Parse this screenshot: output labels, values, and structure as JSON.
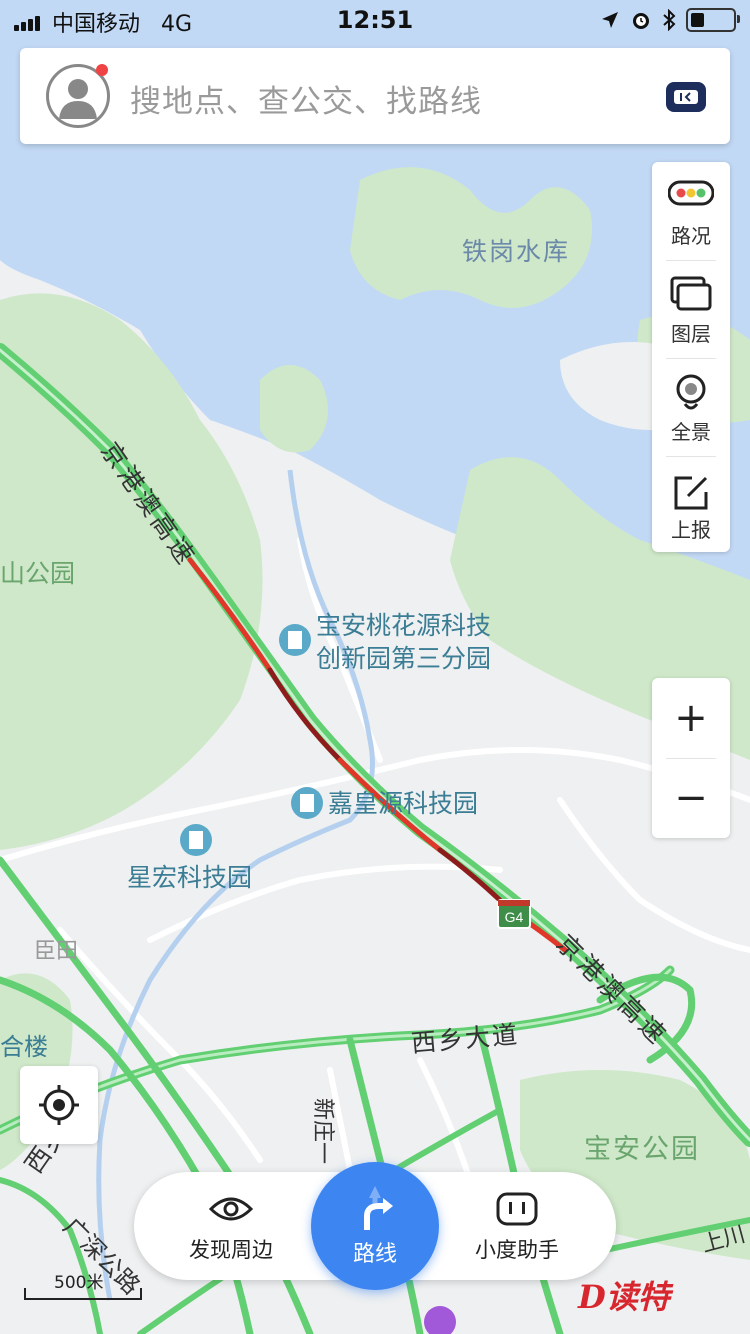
{
  "status_bar": {
    "carrier": "中国移动",
    "network": "4G",
    "time": "12:51"
  },
  "search": {
    "placeholder": "搜地点、查公交、找路线",
    "has_notification": true
  },
  "map_tools": [
    {
      "label": "路况",
      "icon": "traffic-light-icon"
    },
    {
      "label": "图层",
      "icon": "layers-icon"
    },
    {
      "label": "全景",
      "icon": "panorama-pin-icon"
    },
    {
      "label": "上报",
      "icon": "report-edit-icon"
    }
  ],
  "zoom": {
    "in": "+",
    "out": "−"
  },
  "map_labels": {
    "reservoir": "铁岗水库",
    "park_left": "山公园",
    "highway_upper": "京港澳高速",
    "highway_lower": "京港澳高速",
    "poi_1_line1": "宝安桃花源科技",
    "poi_1_line2": "创新园第三分园",
    "poi_2": "嘉皇源科技园",
    "poi_3": "星宏科技园",
    "district": "臣田",
    "building": "合楼",
    "road_xixiang": "西乡大道",
    "road_xinzhuang": "新庄一",
    "road_left": "西乡大道",
    "road_guangshen": "广深公路",
    "park_baoan": "宝安公园",
    "road_shangchuan": "上川",
    "shield": "G4"
  },
  "bottom_bar": {
    "discover": "发现周边",
    "route": "路线",
    "assistant": "小度助手"
  },
  "scale": "500米",
  "watermark": "读特",
  "colors": {
    "water": "#c2d9f5",
    "green": "#cfe8c9",
    "road_green": "#62cf72",
    "road_red": "#e1362a",
    "road_darkred": "#8f1c1c",
    "route_blue": "#3d86f2"
  }
}
